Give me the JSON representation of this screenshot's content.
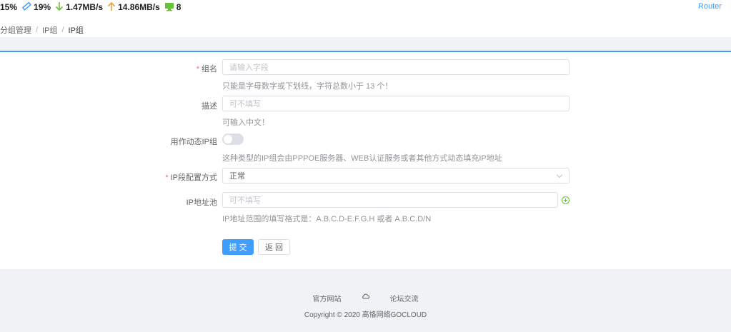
{
  "status": {
    "cpu": "15%",
    "mem": "19%",
    "down": "1.47MB/s",
    "up": "14.86MB/s",
    "clients": "8"
  },
  "router_link": "Router",
  "breadcrumb": [
    "分组管理",
    "IP组",
    "IP组"
  ],
  "form": {
    "name_label": "组名",
    "name_placeholder": "请输入字段",
    "name_hint": "只能是字母数字或下划线，字符总数小于 13 个！",
    "desc_label": "描述",
    "desc_placeholder": "可不填写",
    "desc_hint": "可输入中文！",
    "dynamic_label": "用作动态IP组",
    "dynamic_hint": "这种类型的IP组会由PPPOE服务器、WEB认证服务或者其他方式动态填充IP地址",
    "mode_label": "IP段配置方式",
    "mode_value": "正常",
    "pool_label": "IP地址池",
    "pool_placeholder": "可不填写",
    "pool_hint": "IP地址范围的填写格式是：A.B.C.D-E.F.G.H 或者 A.B.C.D/N",
    "submit": "提 交",
    "back": "返 回"
  },
  "footer": {
    "site": "官方网站",
    "forum": "论坛交流",
    "copyright": "Copyright © 2020 高恪网络GOCLOUD"
  },
  "colors": {
    "primary": "#409eff",
    "success": "#67c23a",
    "danger": "#f56c6c"
  }
}
